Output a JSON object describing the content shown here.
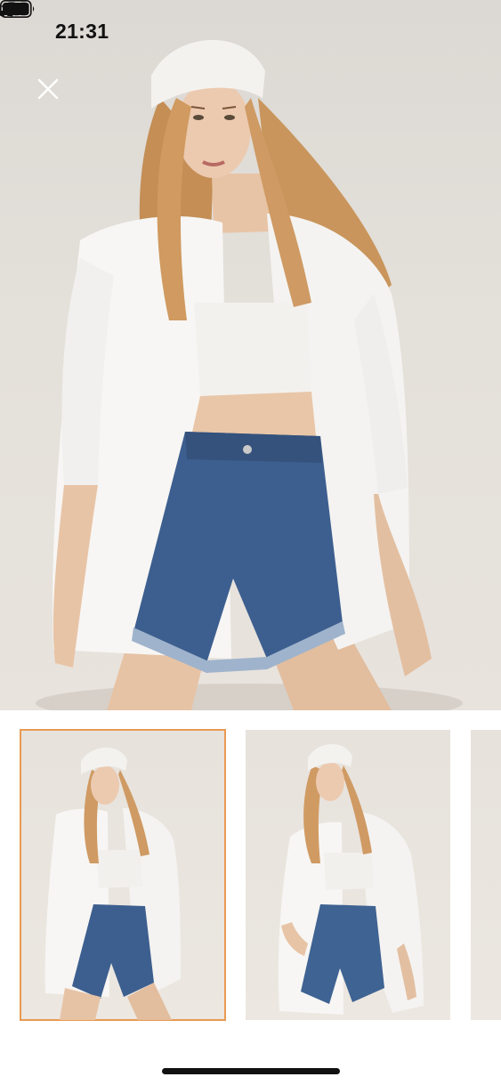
{
  "status_bar": {
    "time": "21:31",
    "icons": [
      "cellular-signal-icon",
      "wifi-icon",
      "battery-icon"
    ]
  },
  "viewer": {
    "close_icon": "close-icon",
    "selected_thumbnail_index": 0,
    "thumbnail_count_visible": 3
  },
  "colors": {
    "selected_border": "#e89a52",
    "backdrop": "#e4e0da",
    "shirt": "#f7f6f4",
    "denim": "#3d5f8f",
    "hair": "#c9955c"
  }
}
